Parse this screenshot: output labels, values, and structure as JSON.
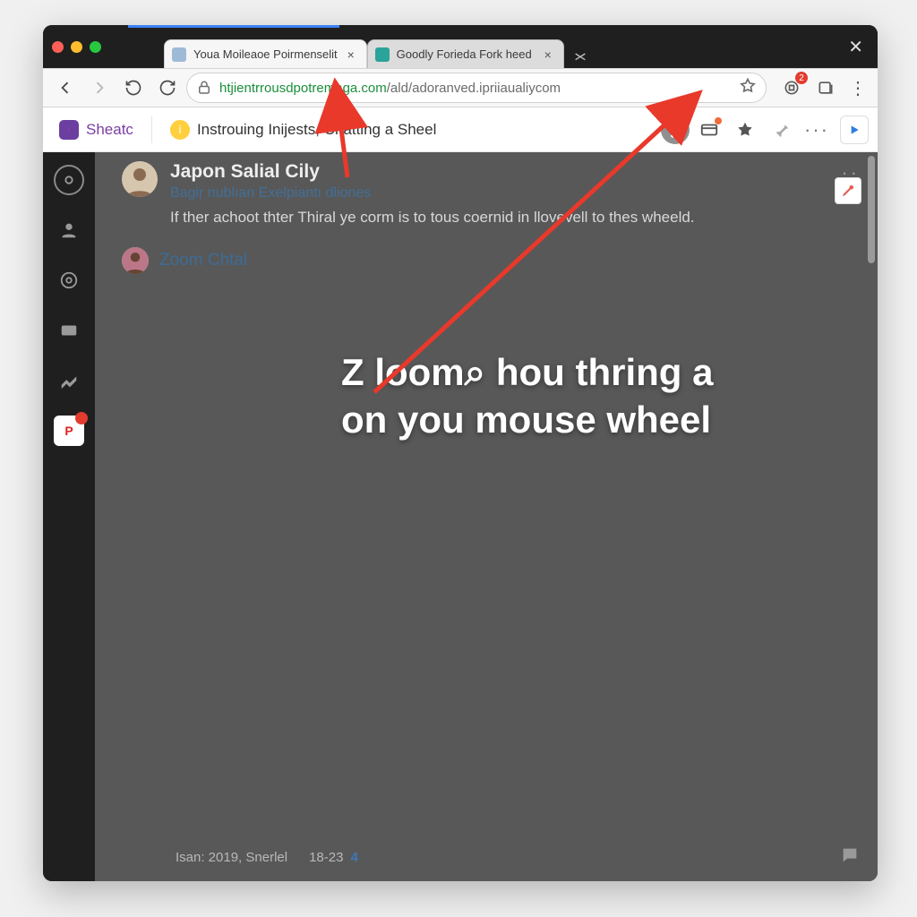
{
  "tabs": [
    {
      "title": "Youa Moileaoe Poirmenselit"
    },
    {
      "title": "Goodly Forieda Fork heed"
    }
  ],
  "url": {
    "secure": "htjient",
    "host": "rrousdpotremaga.com",
    "path": "/ald/adoranved.ipriiaualiycom"
  },
  "extensions": {
    "badge1": "2"
  },
  "bookmarks": {
    "item1": "Sheatc",
    "item2": "Instrouing Inijests, Chatting a Sheel"
  },
  "post": {
    "author": "Japon Salial Cily",
    "subtitle": "Bagiŗ nublıan Exelpiantı dliones",
    "body": "If ther achoot thter Thiral ye corm is to tous coernid in llovevell to thes wheeld."
  },
  "reply": {
    "name": "Zoom Chtal"
  },
  "overlay": {
    "line1": "Z loom⌕ hou thring a",
    "line2": "on you mouse wheel"
  },
  "footer": {
    "left": "Isan: 2019,  Snerlel",
    "mid": "18-23",
    "num": "4"
  }
}
